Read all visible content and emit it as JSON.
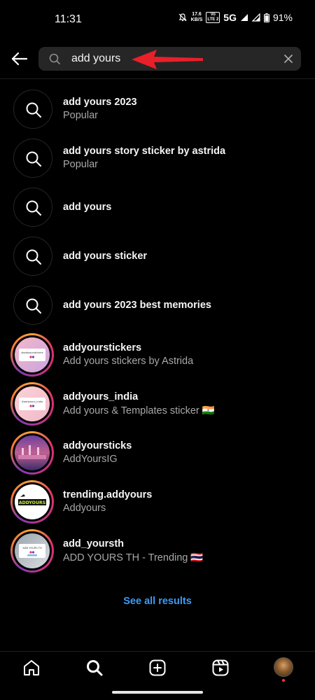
{
  "status_bar": {
    "time": "11:31",
    "speed_value": "17.6",
    "speed_unit": "KB/S",
    "volte_line1": "Vo",
    "volte_line2": "LTE 2",
    "network": "5G",
    "battery": "91%"
  },
  "search": {
    "query": "add yours",
    "back_icon": "arrow-left-icon",
    "clear_icon": "close-icon"
  },
  "results": [
    {
      "type": "keyword",
      "title": "add yours 2023",
      "subtitle": "Popular"
    },
    {
      "type": "keyword",
      "title": "add yours story sticker by astrida",
      "subtitle": "Popular"
    },
    {
      "type": "keyword",
      "title": "add yours",
      "subtitle": ""
    },
    {
      "type": "keyword",
      "title": "add yours sticker",
      "subtitle": ""
    },
    {
      "type": "keyword",
      "title": "add yours 2023 best memories",
      "subtitle": ""
    },
    {
      "type": "account",
      "title": "addyourstickers",
      "subtitle": "Add yours stickers by Astrida"
    },
    {
      "type": "account",
      "title": "addyours_india",
      "subtitle": "Add yours & Templates sticker 🇮🇳"
    },
    {
      "type": "account",
      "title": "addyoursticks",
      "subtitle": "AddYoursIG"
    },
    {
      "type": "account",
      "title": "trending.addyours",
      "subtitle": "Addyours"
    },
    {
      "type": "account",
      "title": "add_yoursth",
      "subtitle": "ADD YOURS TH - Trending 🇹🇭"
    }
  ],
  "avatar_texts": {
    "addyourstickers": "#addyourstickers",
    "addyours_india": "#addyours_india",
    "trending": "ADDYOURS",
    "add_yoursth": "ADD YOURS TH"
  },
  "see_all": "See all results",
  "bottom_nav": [
    "home-icon",
    "search-icon",
    "create-icon",
    "reels-icon",
    "profile-avatar"
  ],
  "colors": {
    "link": "#3b9cf7",
    "annotation_arrow": "#e8202a"
  }
}
